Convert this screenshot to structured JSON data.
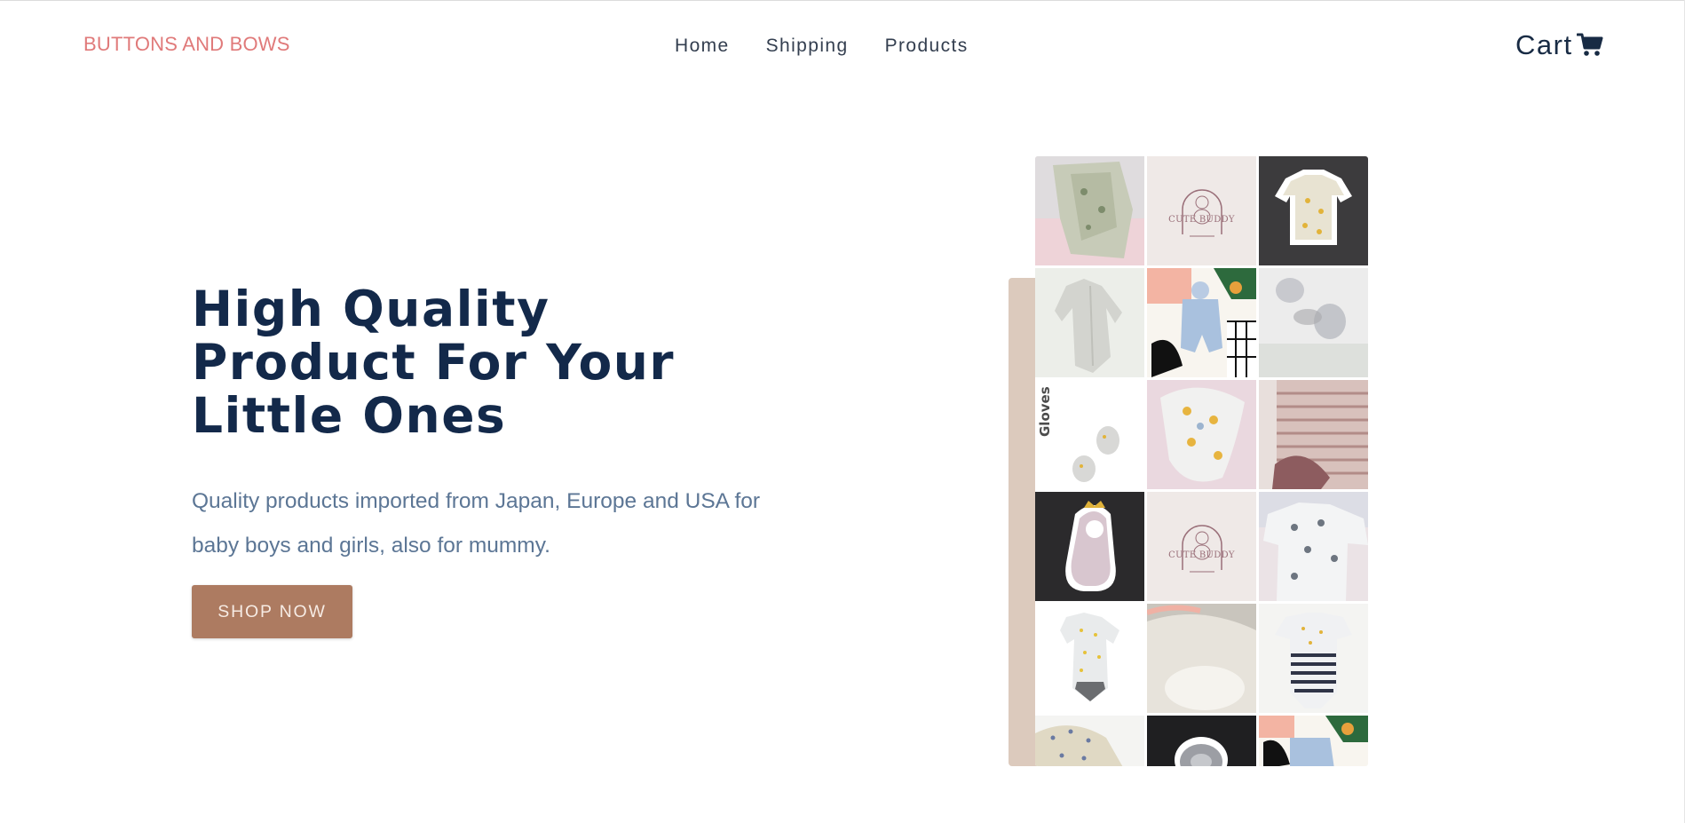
{
  "header": {
    "brand": "BUTTONS AND BOWS",
    "nav": [
      {
        "label": "Home"
      },
      {
        "label": "Shipping"
      },
      {
        "label": "Products"
      }
    ],
    "cart": {
      "label": "Cart",
      "icon": "cart-icon"
    }
  },
  "hero": {
    "title": "High Quality Product For Your Little Ones",
    "subtitle": "Quality products imported from Japan, Europe and USA for baby boys and girls, also for mummy.",
    "cta": "SHOP NOW"
  },
  "gallery": {
    "logo_text": "CUTE BUDDY",
    "gloves_label": "Gloves"
  },
  "colors": {
    "brand": "#e07a7a",
    "heading": "#13294a",
    "subtext": "#5c7695",
    "button": "#ad7b61",
    "accent_panel": "#dccabd"
  }
}
